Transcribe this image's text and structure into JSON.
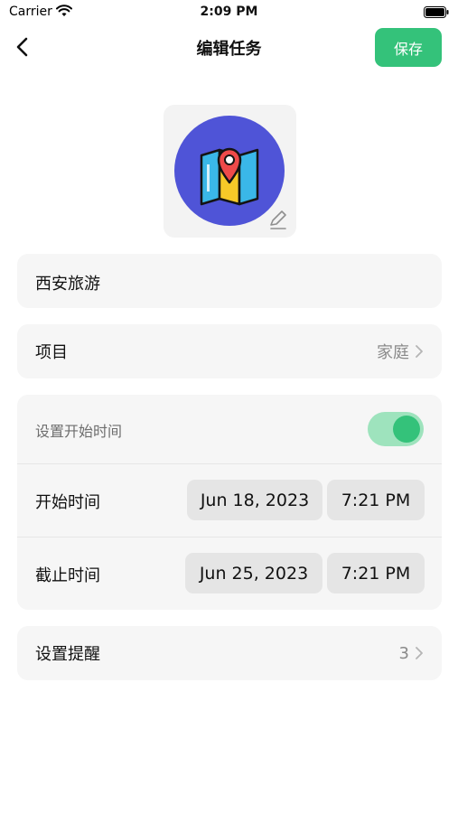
{
  "status_bar": {
    "carrier": "Carrier",
    "time": "2:09 PM"
  },
  "nav": {
    "title": "编辑任务",
    "save_label": "保存"
  },
  "icon": {
    "name": "map-pin-icon",
    "background": "#4f54d7"
  },
  "task": {
    "name": "西安旅游"
  },
  "project": {
    "label": "项目",
    "value": "家庭"
  },
  "time_settings": {
    "toggle_label": "设置开始时间",
    "toggle_on": true,
    "start": {
      "label": "开始时间",
      "date": "Jun 18, 2023",
      "time": "7:21 PM"
    },
    "end": {
      "label": "截止时间",
      "date": "Jun 25, 2023",
      "time": "7:21 PM"
    }
  },
  "reminder": {
    "label": "设置提醒",
    "value": "3"
  },
  "colors": {
    "accent": "#34c27a",
    "toggle_track": "#9ee3bd",
    "card": "#f6f6f6",
    "pill": "#e5e5e5"
  }
}
